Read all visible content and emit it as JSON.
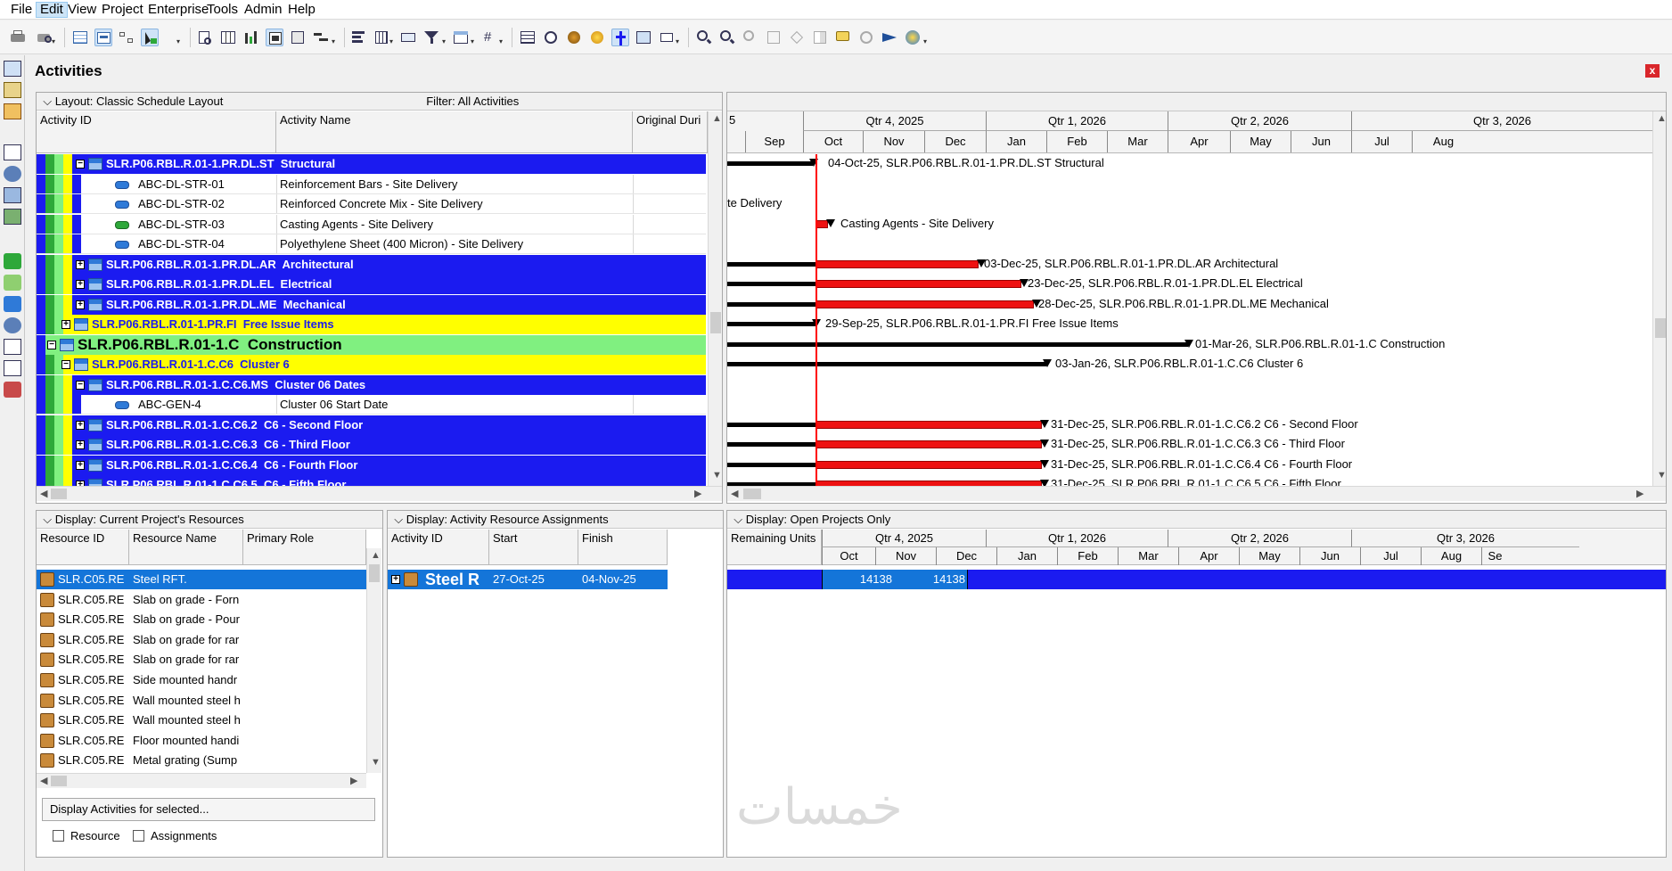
{
  "menu": [
    "File",
    "Edit",
    "View",
    "Project",
    "Enterprise",
    "Tools",
    "Admin",
    "Help"
  ],
  "active_menu": "Edit",
  "title": "Activities",
  "close_label": "x",
  "activities_panel": {
    "layout_label": "Layout: Classic Schedule Layout",
    "filter_label": "Filter: All Activities",
    "columns": [
      "Activity ID",
      "Activity Name",
      "Original Duri"
    ],
    "rows": [
      {
        "kind": "wbs-blue",
        "expander": "−",
        "id": "SLR.P06.RBL.R.01-1.PR.DL.ST",
        "name": "Structural"
      },
      {
        "kind": "task",
        "id": "ABC-DL-STR-01",
        "name": "Reinforcement Bars  - Site Delivery"
      },
      {
        "kind": "task",
        "id": "ABC-DL-STR-02",
        "name": "Reinforced Concrete Mix  - Site Delivery"
      },
      {
        "kind": "task",
        "id": "ABC-DL-STR-03",
        "name": "Casting Agents - Site Delivery",
        "green": true
      },
      {
        "kind": "task",
        "id": "ABC-DL-STR-04",
        "name": "Polyethylene Sheet (400 Micron) - Site Delivery"
      },
      {
        "kind": "wbs-blue",
        "expander": "+",
        "id": "SLR.P06.RBL.R.01-1.PR.DL.AR",
        "name": "Architectural"
      },
      {
        "kind": "wbs-blue",
        "expander": "+",
        "id": "SLR.P06.RBL.R.01-1.PR.DL.EL",
        "name": "Electrical"
      },
      {
        "kind": "wbs-blue",
        "expander": "+",
        "id": "SLR.P06.RBL.R.01-1.PR.DL.ME",
        "name": "Mechanical"
      },
      {
        "kind": "wbs-yellow",
        "expander": "+",
        "id": "SLR.P06.RBL.R.01-1.PR.FI",
        "name": "Free Issue Items"
      },
      {
        "kind": "wbs-green",
        "expander": "−",
        "id": "SLR.P06.RBL.R.01-1.C",
        "name": "Construction"
      },
      {
        "kind": "wbs-yellow",
        "expander": "−",
        "id": "SLR.P06.RBL.R.01-1.C.C6",
        "name": "Cluster 6"
      },
      {
        "kind": "wbs-blue",
        "expander": "−",
        "id": "SLR.P06.RBL.R.01-1.C.C6.MS",
        "name": "Cluster 06 Dates"
      },
      {
        "kind": "task",
        "id": "ABC-GEN-4",
        "name": "Cluster 06 Start Date"
      },
      {
        "kind": "wbs-blue",
        "expander": "+",
        "id": "SLR.P06.RBL.R.01-1.C.C6.2",
        "name": "C6 - Second Floor"
      },
      {
        "kind": "wbs-blue",
        "expander": "+",
        "id": "SLR.P06.RBL.R.01-1.C.C6.3",
        "name": "C6 - Third Floor"
      },
      {
        "kind": "wbs-blue",
        "expander": "+",
        "id": "SLR.P06.RBL.R.01-1.C.C6.4",
        "name": "C6 - Fourth Floor"
      },
      {
        "kind": "wbs-blue",
        "expander": "+",
        "id": "SLR.P06.RBL.R.01-1.C.C6.5",
        "name": "C6 - Fifth Floor"
      }
    ]
  },
  "gantt": {
    "quarters": [
      "Qtr 4, 2025",
      "Qtr 1, 2026",
      "Qtr 2, 2026",
      "Qtr 3, 2026"
    ],
    "months": [
      "Sep",
      "Oct",
      "Nov",
      "Dec",
      "Jan",
      "Feb",
      "Mar",
      "Apr",
      "May",
      "Jun",
      "Jul",
      "Aug"
    ],
    "partial_label": "5",
    "labels": [
      "04-Oct-25, SLR.P06.RBL.R.01-1.PR.DL.ST  Structural",
      "te Delivery",
      "Casting Agents - Site Delivery",
      "03-Dec-25, SLR.P06.RBL.R.01-1.PR.DL.AR  Architectural",
      "23-Dec-25, SLR.P06.RBL.R.01-1.PR.DL.EL  Electrical",
      "28-Dec-25, SLR.P06.RBL.R.01-1.PR.DL.ME  Mechanical",
      "29-Sep-25, SLR.P06.RBL.R.01-1.PR.FI  Free Issue Items",
      "01-Mar-26, SLR.P06.RBL.R.01-1.C  Construction",
      "03-Jan-26, SLR.P06.RBL.R.01-1.C.C6  Cluster 6",
      "31-Dec-25, SLR.P06.RBL.R.01-1.C.C6.2  C6 - Second Floor",
      "31-Dec-25, SLR.P06.RBL.R.01-1.C.C6.3  C6 - Third Floor",
      "31-Dec-25, SLR.P06.RBL.R.01-1.C.C6.4  C6 - Fourth Floor",
      "31-Dec-25, SLR.P06.RBL.R.01-1.C.C6.5  C6 - Fifth Floor"
    ]
  },
  "resources_panel": {
    "display_label": "Display: Current Project's Resources",
    "columns": [
      "Resource ID",
      "Resource Name",
      "Primary Role"
    ],
    "rows": [
      {
        "id": "SLR.C05.RE",
        "name": "Steel RFT.",
        "selected": true
      },
      {
        "id": "SLR.C05.RE",
        "name": "Slab on grade - Forn"
      },
      {
        "id": "SLR.C05.RE",
        "name": "Slab on grade - Pour"
      },
      {
        "id": "SLR.C05.RE",
        "name": "Slab on grade for rar"
      },
      {
        "id": "SLR.C05.RE",
        "name": "Slab on grade for rar"
      },
      {
        "id": "SLR.C05.RE",
        "name": "Side mounted handr"
      },
      {
        "id": "SLR.C05.RE",
        "name": "Wall mounted steel h"
      },
      {
        "id": "SLR.C05.RE",
        "name": "Wall mounted steel h"
      },
      {
        "id": "SLR.C05.RE",
        "name": "Floor mounted handi"
      },
      {
        "id": "SLR.C05.RE",
        "name": "Metal grating (Sump"
      }
    ],
    "display_activities_label": "Display Activities for selected...",
    "resource_checkbox": "Resource",
    "assignments_checkbox": "Assignments"
  },
  "assignments_panel": {
    "display_label": "Display: Activity Resource Assignments",
    "columns": [
      "Activity ID",
      "Start",
      "Finish"
    ],
    "row": {
      "id": "Steel R",
      "start": "27-Oct-25",
      "finish": "04-Nov-25"
    }
  },
  "usage_panel": {
    "display_label": "Display: Open Projects Only",
    "column": "Remaining Units",
    "quarters": [
      "Qtr 4, 2025",
      "Qtr 1, 2026",
      "Qtr 2, 2026",
      "Qtr 3, 2026"
    ],
    "months": [
      "Oct",
      "Nov",
      "Dec",
      "Jan",
      "Feb",
      "Mar",
      "Apr",
      "May",
      "Jun",
      "Jul",
      "Aug",
      "Se"
    ],
    "values": [
      "14138",
      "14138"
    ]
  },
  "watermark": "خمسات",
  "colors": {
    "wbs_blue": "#1b1bf0",
    "wbs_yellow": "#ffff00",
    "wbs_green": "#80f080",
    "bar_red": "#ee1111",
    "selection": "#1475d9",
    "data_date": "#ff0000"
  }
}
